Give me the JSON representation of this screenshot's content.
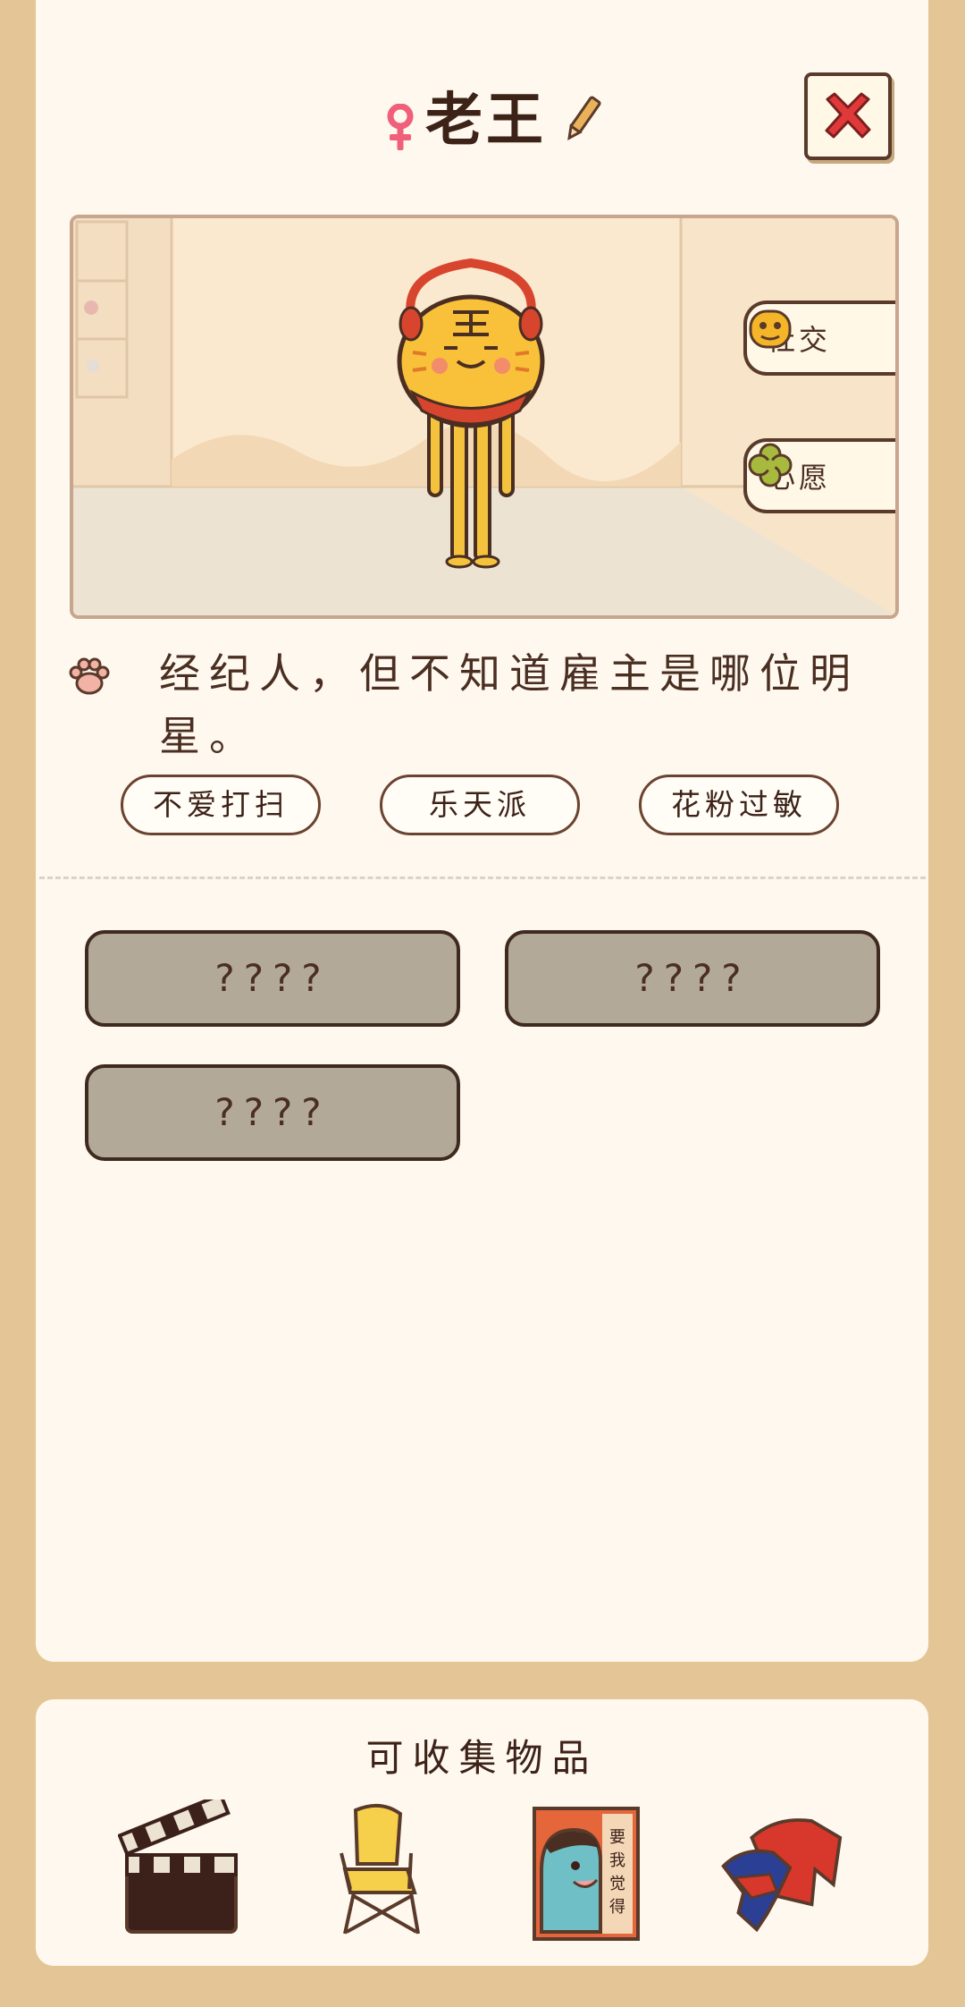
{
  "character": {
    "name": "老王",
    "gender_icon": "female-icon",
    "pencil_icon": "pencil-edit-icon",
    "close_icon": "close-x-icon"
  },
  "scene": {
    "social_label": "社交",
    "wish_label": "心愿"
  },
  "description": {
    "text": "经纪人，但不知道雇主是哪位明星。"
  },
  "tags": [
    "不爱打扫",
    "乐天派",
    "花粉过敏"
  ],
  "locked_slots": [
    "????",
    "????",
    "????"
  ],
  "collectibles": {
    "title": "可收集物品",
    "items": [
      "clapperboard-icon",
      "folding-chair-icon",
      "poster-icon",
      "clothes-icon"
    ]
  },
  "colors": {
    "background": "#E4C595",
    "card": "#FEF8EE",
    "outline": "#4A2E22",
    "close_red": "#E0393A",
    "locked_slot": "#B3A999",
    "gender_pink": "#F0607A"
  }
}
